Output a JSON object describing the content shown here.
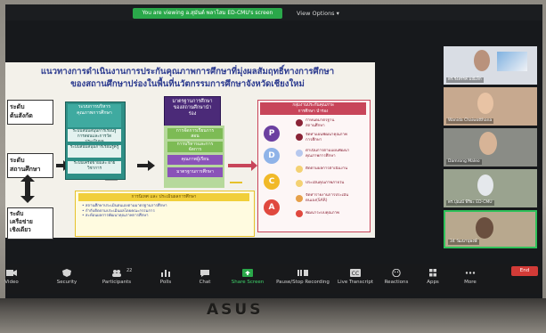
{
  "zoom": {
    "view_banner": "You are viewing a.สุมันต์ พลาโสม ED-CMU's screen",
    "view_options": "View Options ▾"
  },
  "slide": {
    "title_line1": "แนวทางการดำเนินงานการประกันคุณภาพการศึกษาที่มุ่งผลสัมฤทธิ์ทางการศึกษา",
    "title_line2": "ของสถานศึกษาปร่องในพื้นที่นวัตกรรมการศึกษาจังหวัดเชียงใหม่",
    "left_box_1": "ระดับ\nต้นสังกัด",
    "left_box_2": "ระดับ\nสถานศึกษา",
    "left_box_3": "ระดับ\nเครือข่าย\nเชิงเดียว",
    "teal_title": "ระบบการบริหาร\nคุณภาพการศึกษา",
    "teal_items": [
      "ระบบสนับสนุนการเรียนรู้\nการสอนและการวัด\nประเมินผล",
      "ระบบสนับสนุนการเรียนรู้ครู",
      "ระบบเครือข่ายและ ฝ่าย\nวิชาการ"
    ],
    "purple_title": "มาตรฐานการศึกษา\nของสถานศึกษานำ\nร่อง",
    "green_items": [
      "การจัดการเรียนการ\nสอน",
      "การบริหารและการ\nจัดการ"
    ],
    "purple_items": [
      "คุณภาพผู้เรียน",
      "มาตรฐานการศึกษา"
    ],
    "red_head": "กลุ่มงานประกันคุณภาพ\nการศึกษา นำร่อง",
    "pdca": [
      "P",
      "D",
      "C",
      "A"
    ],
    "red_items": [
      "กำหนดมาตรฐาน\nสถานศึกษา",
      "จัดทำแผนพัฒนาคุณภาพ\nการศึกษา",
      "ดำเนินการตามแผนพัฒนา\nคุณภาพการศึกษา",
      "ติดตามผลการดำเนินงาน",
      "ประเมินคุณภาพภายใน",
      "จัดทำรายงานการประเมิน\nตนเอง(SAR)",
      "พัฒนาระบบคุณภาพ"
    ],
    "yellow_head": "การนิเทศ และ ประเมินผลการศึกษา",
    "yellow_lines": [
      "• สถานศึกษาประเมินตนเองตามมาตรฐานการศึกษา",
      "• กำกับติดตามประเมินผลโดยคณะกรรมการ",
      "• สะท้อนผลการพัฒนาคุณภาพการศึกษา"
    ]
  },
  "gallery": [
    {
      "name": "ดร.รังสรรค์ มณีเล็ก"
    },
    {
      "name": "Wanida Chaiwatthana"
    },
    {
      "name": "Damrong Maleo"
    },
    {
      "name": "ดร.ปุณณ์ พิริยะ ED-CMU"
    },
    {
      "name": "34 วัฒนานุพงษ์"
    }
  ],
  "toolbar": {
    "items": [
      "Video",
      "Security",
      "Participants",
      "Polls",
      "Chat",
      "Share Screen",
      "Pause/Stop Recording",
      "Live Transcript",
      "Reactions",
      "Apps",
      "More"
    ],
    "participants_count": "22",
    "end_label": "End"
  },
  "brand": "ASUS"
}
